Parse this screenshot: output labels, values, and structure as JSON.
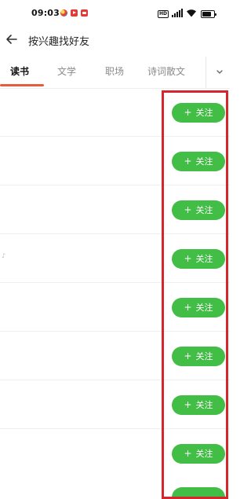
{
  "status_bar": {
    "time": "09:03",
    "hd_label": "HD"
  },
  "header": {
    "title": "按兴趣找好友"
  },
  "tabs": [
    {
      "label": "读书",
      "active": true
    },
    {
      "label": "文学",
      "active": false
    },
    {
      "label": "职场",
      "active": false
    },
    {
      "label": "诗词散文",
      "active": false
    }
  ],
  "list": {
    "follow_label": "关注",
    "follow_plus": "+",
    "items": [
      {
        "follow_label": "关注"
      },
      {
        "follow_label": "关注"
      },
      {
        "follow_label": "关注"
      },
      {
        "follow_label": "关注"
      },
      {
        "follow_label": "关注"
      },
      {
        "follow_label": "关注"
      },
      {
        "follow_label": "关注"
      },
      {
        "follow_label": "关注"
      }
    ],
    "partial_glyph": "♪"
  },
  "colors": {
    "follow_green": "#42bd45",
    "tab_indicator": "#e85c3c",
    "highlight_red": "#d6262d"
  },
  "icons": {
    "back": "arrow-left-icon",
    "more": "chevron-down-icon"
  }
}
